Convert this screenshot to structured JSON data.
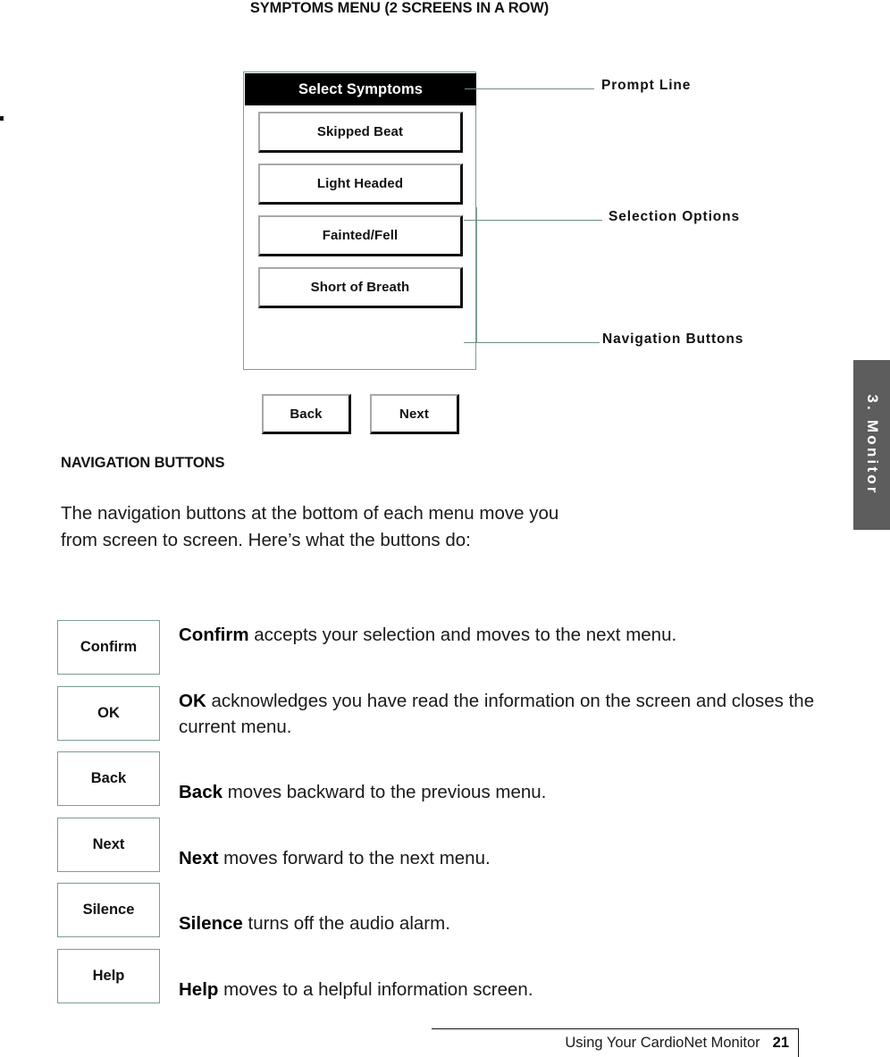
{
  "page": {
    "title": "SYMPTOMS  MENU (2 SCREENS IN A ROW)",
    "accent_green": "#7d9e90",
    "callout_line_color": "#6d9080",
    "tab_color": "#5d5d5d"
  },
  "device_screen": {
    "prompt_line": "Select Symptoms",
    "options": [
      "Skipped Beat",
      "Light Headed",
      "Fainted/Fell",
      "Short of Breath"
    ],
    "nav_back": "Back",
    "nav_next": "Next"
  },
  "callouts": [
    {
      "label": "Prompt Line"
    },
    {
      "label": "Selection  Options"
    },
    {
      "label": "Navigation  Buttons"
    }
  ],
  "section": {
    "heading": "NAVIGATION BUTTONS",
    "body": "The navigation buttons at the bottom of each menu move you from screen to screen. Here’s what the buttons do:"
  },
  "button_table": {
    "rows": [
      {
        "key": "Confirm",
        "bold": "Confirm",
        "text": " accepts your selection and moves to the next menu.",
        "lines": 2
      },
      {
        "key": "OK",
        "bold": "OK",
        "text": " acknowledges you have read the information on the screen and closes the current menu.",
        "lines": 2
      },
      {
        "key": "Back",
        "bold": "Back",
        "text": " moves backward to the previous menu.",
        "lines": 1
      },
      {
        "key": "Next",
        "bold": "Next",
        "text": "  moves forward to the next menu.",
        "lines": 1
      },
      {
        "key": "Silence",
        "bold": "Silence",
        "text": " turns off the audio alarm.",
        "lines": 1
      },
      {
        "key": "Help",
        "bold": "Help",
        "text": " moves to a helpful information screen.",
        "lines": 1
      }
    ]
  },
  "chapter_tab": {
    "text": "3.  Monitor"
  },
  "footer": {
    "text": "Using Your CardioNet Monitor",
    "page_number": "21"
  }
}
